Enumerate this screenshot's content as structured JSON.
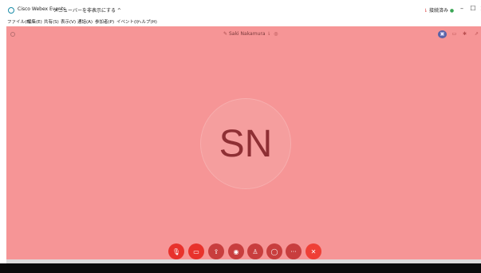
{
  "window": {
    "title": "Cisco Webex Events",
    "menu_toggle": "メニューバーを非表示にする ^",
    "connection_status": "接続済み",
    "minimize_glyph": "–",
    "maximize_glyph": "☐",
    "close_glyph": "×"
  },
  "menubar": {
    "items": [
      {
        "label": "ファイル(F)"
      },
      {
        "label": "編集(E)"
      },
      {
        "label": "共有(S)"
      },
      {
        "label": "表示(V)"
      },
      {
        "label": "通話(A)"
      },
      {
        "label": "参加者(P)"
      },
      {
        "label": "イベント(I)"
      },
      {
        "label": "ヘルプ(H)"
      }
    ]
  },
  "stage": {
    "speaker_name": "Saki Nakamura",
    "avatar_initials": "SN",
    "background_color": "#f69596"
  },
  "controls": [
    {
      "name": "mute-button",
      "icon": "mic-icon",
      "glyph": "🎙"
    },
    {
      "name": "video-button",
      "icon": "video-camera-icon",
      "glyph": "▭"
    },
    {
      "name": "share-button",
      "icon": "share-icon",
      "glyph": "⇪"
    },
    {
      "name": "record-button",
      "icon": "record-icon",
      "glyph": "◉"
    },
    {
      "name": "participants-button",
      "icon": "participants-icon",
      "glyph": "♙"
    },
    {
      "name": "chat-button",
      "icon": "chat-icon",
      "glyph": "◯"
    },
    {
      "name": "more-options-button",
      "icon": "more-icon",
      "glyph": "···"
    },
    {
      "name": "leave-button",
      "icon": "close-icon",
      "glyph": "✕"
    }
  ],
  "colors": {
    "accent_layout": "#5a64a8",
    "control_red": "#e8322c",
    "control_dark": "#c83e3e",
    "end_call": "#ef3f36"
  }
}
